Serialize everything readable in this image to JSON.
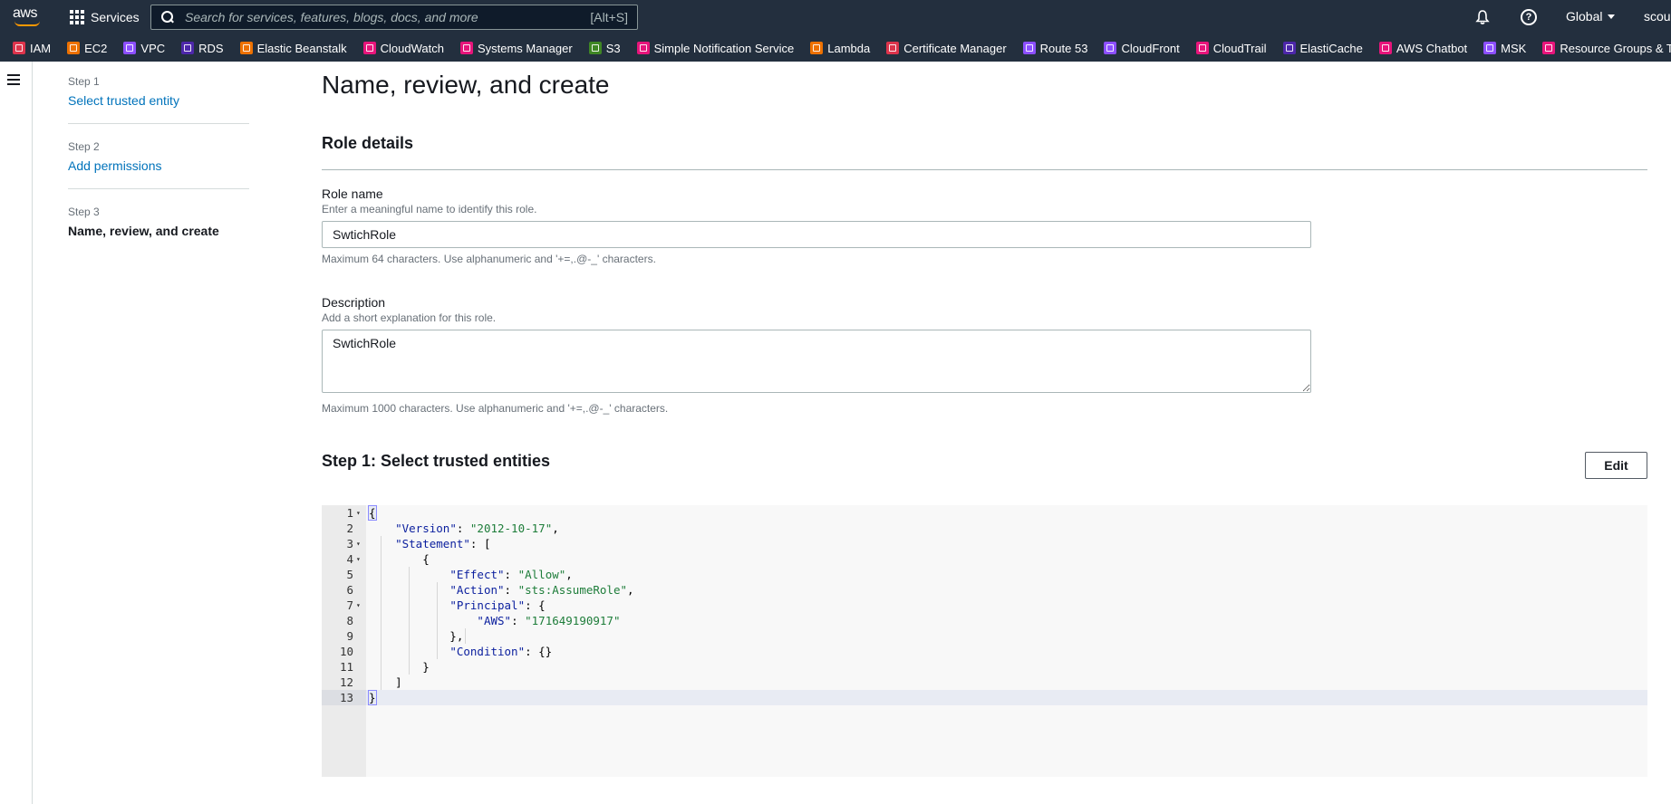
{
  "topnav": {
    "logo_text": "aws",
    "services_label": "Services",
    "search_placeholder": "Search for services, features, blogs, docs, and more",
    "search_shortcut": "[Alt+S]",
    "region": "Global",
    "account": "scour"
  },
  "favorites": [
    {
      "label": "IAM",
      "icon": "iam-icon",
      "color": "#dd344c"
    },
    {
      "label": "EC2",
      "icon": "ec2-icon",
      "color": "#ed7100"
    },
    {
      "label": "VPC",
      "icon": "vpc-icon",
      "color": "#8c4fff"
    },
    {
      "label": "RDS",
      "icon": "rds-icon",
      "color": "#4d27aa"
    },
    {
      "label": "Elastic Beanstalk",
      "icon": "elastic-beanstalk-icon",
      "color": "#ed7100"
    },
    {
      "label": "CloudWatch",
      "icon": "cloudwatch-icon",
      "color": "#e7157b"
    },
    {
      "label": "Systems Manager",
      "icon": "systems-manager-icon",
      "color": "#e7157b"
    },
    {
      "label": "S3",
      "icon": "s3-icon",
      "color": "#3f8624"
    },
    {
      "label": "Simple Notification Service",
      "icon": "sns-icon",
      "color": "#e7157b"
    },
    {
      "label": "Lambda",
      "icon": "lambda-icon",
      "color": "#ed7100"
    },
    {
      "label": "Certificate Manager",
      "icon": "certificate-manager-icon",
      "color": "#dd344c"
    },
    {
      "label": "Route 53",
      "icon": "route53-icon",
      "color": "#8c4fff"
    },
    {
      "label": "CloudFront",
      "icon": "cloudfront-icon",
      "color": "#8c4fff"
    },
    {
      "label": "CloudTrail",
      "icon": "cloudtrail-icon",
      "color": "#e7157b"
    },
    {
      "label": "ElastiCache",
      "icon": "elasticache-icon",
      "color": "#4d27aa"
    },
    {
      "label": "AWS Chatbot",
      "icon": "aws-chatbot-icon",
      "color": "#e7157b"
    },
    {
      "label": "MSK",
      "icon": "msk-icon",
      "color": "#8c4fff"
    },
    {
      "label": "Resource Groups & Tag Editor",
      "icon": "resource-groups-icon",
      "color": "#e7157b"
    }
  ],
  "steps": [
    {
      "label": "Step 1",
      "title": "Select trusted entity"
    },
    {
      "label": "Step 2",
      "title": "Add permissions"
    },
    {
      "label": "Step 3",
      "title": "Name, review, and create"
    }
  ],
  "main": {
    "page_title": "Name, review, and create",
    "section_title": "Role details",
    "role_name": {
      "label": "Role name",
      "description": "Enter a meaningful name to identify this role.",
      "value": "SwtichRole",
      "hint": "Maximum 64 characters. Use alphanumeric and '+=,.@-_' characters."
    },
    "description_field": {
      "label": "Description",
      "description": "Add a short explanation for this role.",
      "value": "SwtichRole",
      "hint": "Maximum 1000 characters. Use alphanumeric and '+=,.@-_' characters."
    },
    "trusted_title": "Step 1: Select trusted entities",
    "edit_label": "Edit"
  },
  "policy_lines": [
    {
      "n": "1",
      "fold": true,
      "code": "{"
    },
    {
      "n": "2",
      "fold": false,
      "code": "    \"Version\": \"2012-10-17\","
    },
    {
      "n": "3",
      "fold": true,
      "code": "    \"Statement\": ["
    },
    {
      "n": "4",
      "fold": true,
      "code": "        {"
    },
    {
      "n": "5",
      "fold": false,
      "code": "            \"Effect\": \"Allow\","
    },
    {
      "n": "6",
      "fold": false,
      "code": "            \"Action\": \"sts:AssumeRole\","
    },
    {
      "n": "7",
      "fold": true,
      "code": "            \"Principal\": {"
    },
    {
      "n": "8",
      "fold": false,
      "code": "                \"AWS\": \"171649190917\""
    },
    {
      "n": "9",
      "fold": false,
      "code": "            },"
    },
    {
      "n": "10",
      "fold": false,
      "code": "            \"Condition\": {}"
    },
    {
      "n": "11",
      "fold": false,
      "code": "        }"
    },
    {
      "n": "12",
      "fold": false,
      "code": "    ]"
    },
    {
      "n": "13",
      "fold": false,
      "code": "}"
    }
  ]
}
